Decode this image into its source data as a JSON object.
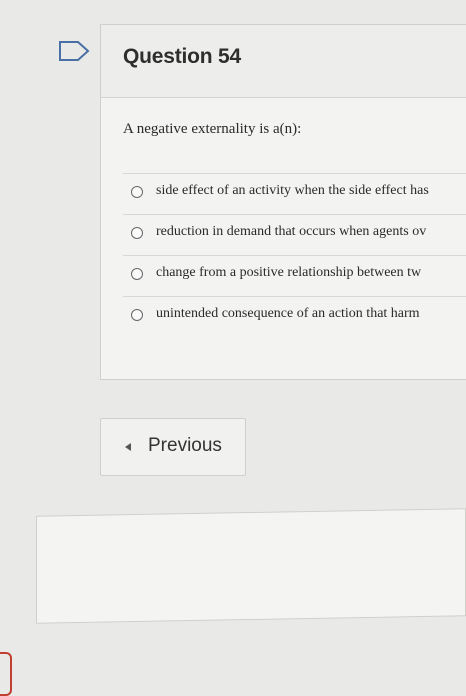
{
  "question": {
    "title": "Question 54",
    "prompt": "A negative externality is a(n):",
    "answers": [
      "side effect of an activity when the side effect has",
      "reduction in demand that occurs when agents ov",
      "change from a positive relationship between tw",
      "unintended consequence of an action that harm"
    ]
  },
  "navigation": {
    "previous_label": "Previous"
  },
  "icons": {
    "flag": "flag-icon",
    "previous": "caret-left-icon",
    "radio": "radio-button-icon"
  }
}
